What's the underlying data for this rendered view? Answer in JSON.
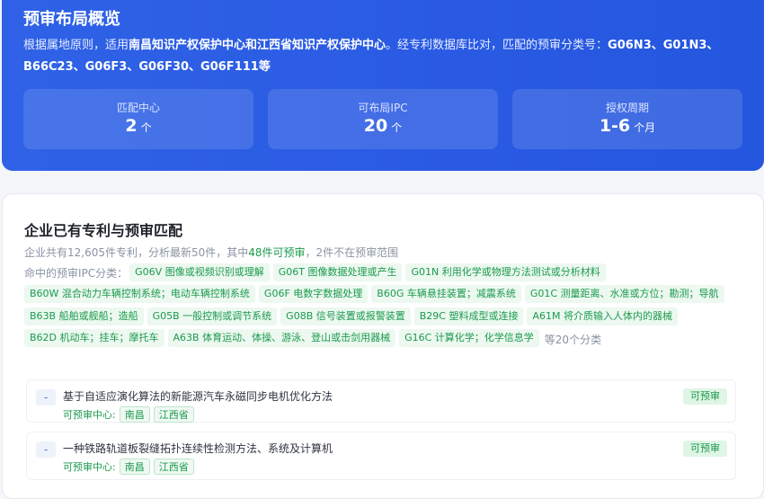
{
  "overview": {
    "title": "预审布局概览",
    "desc_prefix": "根据属地原则，适用",
    "desc_centers": "南昌知识产权保护中心和江西省知识产权保护中心",
    "desc_mid": "。经专利数据库比对，匹配的预审分类号：",
    "desc_codes": "G06N3、G01N3、B66C23、G06F3、G06F30、G06F111等",
    "stats": [
      {
        "label": "匹配中心",
        "value": "2",
        "unit": "个"
      },
      {
        "label": "可布局IPC",
        "value": "20",
        "unit": "个"
      },
      {
        "label": "授权周期",
        "value": "1-6",
        "unit": "个月"
      }
    ]
  },
  "match": {
    "title": "企业已有专利与预审匹配",
    "summary_a": "企业共有12,605件专利，分析最新50件，其中",
    "summary_hl": "48件可预审",
    "summary_b": "，2件不在预审范围",
    "ipc_lead": "命中的预审IPC分类：",
    "ipc_tags": [
      "G06V 图像或视频识别或理解",
      "G06T 图像数据处理或产生",
      "G01N 利用化学或物理方法测试或分析材料",
      "B60W 混合动力车辆控制系统；电动车辆控制系统",
      "G06F 电数字数据处理",
      "B60G 车辆悬挂装置；减震系统",
      "G01C 测量距离、水准或方位；勘测；导航",
      "B63B 船舶或舰船；造船",
      "G05B 一般控制或调节系统",
      "G08B 信号装置或报警装置",
      "B29C 塑料成型或连接",
      "A61M 将介质输入人体内的器械",
      "B62D 机动车；挂车；摩托车",
      "A63B 体育运动、体操、游泳、登山或击剑用器械",
      "G16C 计算化学；化学信息学"
    ],
    "ipc_more": "等20个分类",
    "rows": [
      {
        "dash": "-",
        "title": "基于自适应演化算法的新能源汽车永磁同步电机优化方法",
        "center_label": "可预审中心:",
        "centers": [
          "南昌",
          "江西省"
        ],
        "status": "可预审"
      },
      {
        "dash": "-",
        "title": "一种铁路轨道板裂缝拓扑连续性检测方法、系统及计算机",
        "center_label": "可预审中心:",
        "centers": [
          "南昌",
          "江西省"
        ],
        "status": "可预审"
      }
    ]
  }
}
